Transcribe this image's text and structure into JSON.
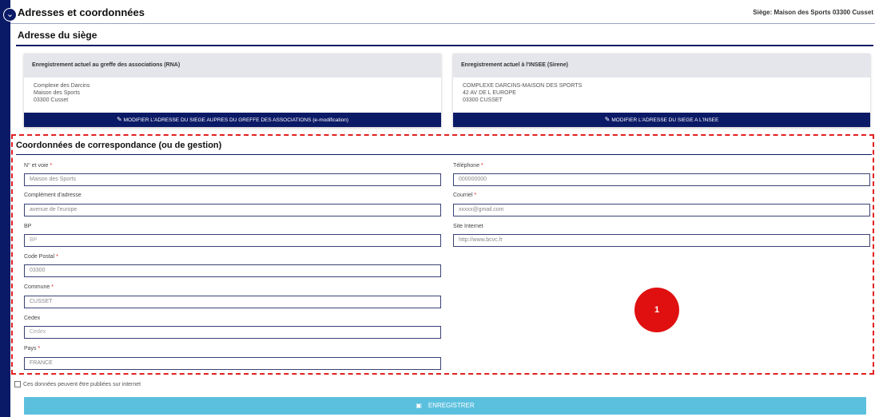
{
  "header": {
    "title": "Adresses et coordonnées",
    "siege": "Siège: Maison des Sports 03300 Cusset",
    "subsection": "Adresse du siège"
  },
  "cards": {
    "rna": {
      "title": "Enregistrement actuel au greffe des associations (RNA)",
      "lines": [
        "Complexe des Darcins",
        "Maison des Sports",
        "03300 Cusset"
      ],
      "button": "MODIFIER L'ADRESSE DU SIEGE AUPRES DU GREFFE DES ASSOCIATIONS (e-modification)"
    },
    "insee": {
      "title": "Enregistrement actuel à l'INSEE (Sirene)",
      "lines": [
        "COMPLEXE DARCINS-MAISON DES SPORTS",
        "42 AV DE L EUROPE",
        "03300 CUSSET"
      ],
      "button": "MODIFIER L'ADRESSE DU SIEGE A L'INSEE"
    }
  },
  "correspondance": {
    "title": "Coordonnées de correspondance (ou de gestion)",
    "fields": {
      "voie": {
        "label": "N° et voie",
        "value": "Maison des Sports"
      },
      "complement": {
        "label": "Complément d'adresse",
        "value": "avenue de l'europe"
      },
      "bp": {
        "label": "BP",
        "placeholder": "BP"
      },
      "cp": {
        "label": "Code Postal",
        "value": "03300"
      },
      "commune": {
        "label": "Commune",
        "value": "CUSSET"
      },
      "cedex": {
        "label": "Cedex",
        "placeholder": "Cedex"
      },
      "pays": {
        "label": "Pays",
        "value": "FRANCE"
      },
      "telephone": {
        "label": "Téléphone",
        "value": "000000000"
      },
      "courriel": {
        "label": "Courriel",
        "value": "xxxxx@gmail.com"
      },
      "site": {
        "label": "Site Internet",
        "value": "http://www.bcvc.fr"
      }
    },
    "required_mark": "*",
    "badge": "1"
  },
  "publish": {
    "label": "Ces données peuvent être publiées sur internet"
  },
  "save": {
    "label": "ENREGISTRER"
  },
  "colors": {
    "navy": "#0b1a66",
    "save": "#5bc0de",
    "badge": "#e01010"
  }
}
